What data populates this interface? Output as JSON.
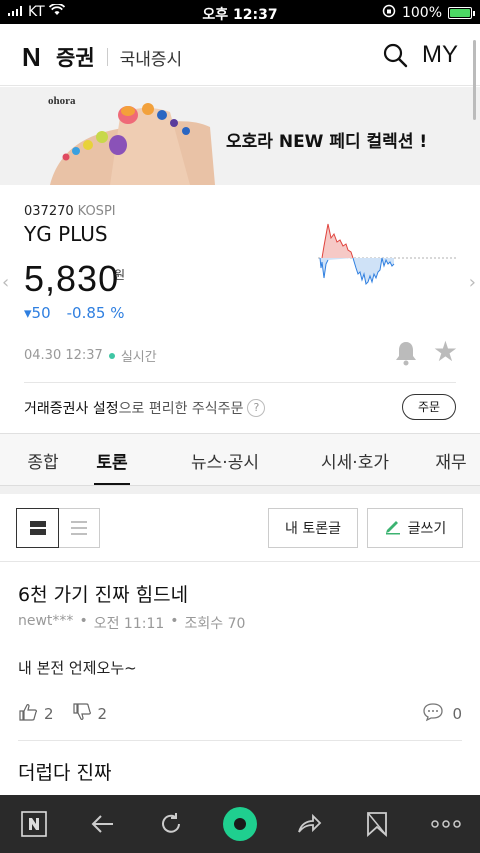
{
  "status_bar": {
    "carrier": "KT",
    "time": "오후 12:37",
    "battery": "100%"
  },
  "header": {
    "logo_letter": "N",
    "title": "증권",
    "subtitle": "국내증시",
    "my": "MY"
  },
  "banner": {
    "brand": "ohora",
    "text": "오호라 NEW 페디 컬렉션 !"
  },
  "stock": {
    "code": "037270",
    "market": "KOSPI",
    "name": "YG PLUS",
    "price": "5,830",
    "unit": "원",
    "change": "▾50",
    "change_pct": "-0.85 %",
    "datetime": "04.30 12:37",
    "realtime": "실시간",
    "promo_bold": "거래증권사 설정",
    "promo_rest": "으로 편리한 주식주문",
    "help": "?",
    "order_button": "주문",
    "colors": {
      "down": "#2f7fe0",
      "up": "#e0443e"
    }
  },
  "tabs": [
    {
      "label": "종합",
      "active": false
    },
    {
      "label": "토론",
      "active": true
    },
    {
      "label": "뉴스·공시",
      "active": false
    },
    {
      "label": "시세·호가",
      "active": false
    },
    {
      "label": "재무",
      "active": false
    }
  ],
  "toolbar": {
    "my_posts": "내 토론글",
    "write": "글쓰기"
  },
  "posts": [
    {
      "title": "6천 가기 진짜 힘드네",
      "author": "newt***",
      "time": "오전 11:11",
      "views": "조회수 70",
      "body": "내 본전 언제오누~",
      "likes": "2",
      "dislikes": "2",
      "comments": "0"
    },
    {
      "title": "더럽다 진짜"
    }
  ]
}
